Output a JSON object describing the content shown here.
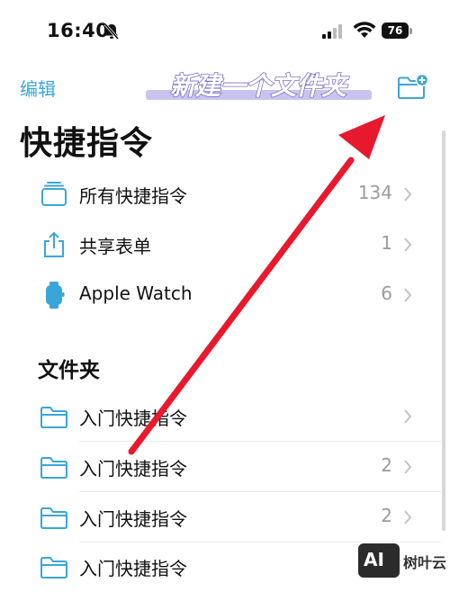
{
  "status_bar": {
    "time": "16:40",
    "battery": "76",
    "icons": [
      "bell-slash-icon",
      "cellular-signal-icon",
      "wifi-icon",
      "battery-icon"
    ]
  },
  "nav": {
    "edit_label": "编辑",
    "banner_text": "新建一个文件夹",
    "new_folder_icon": "folder-plus-icon"
  },
  "page_title": "快捷指令",
  "shortcut_groups": [
    {
      "label": "所有快捷指令",
      "count": "134",
      "icon": "stack-icon"
    },
    {
      "label": "共享表单",
      "count": "1",
      "icon": "share-icon"
    },
    {
      "label": "Apple Watch",
      "count": "6",
      "icon": "apple-watch-icon"
    }
  ],
  "folders_section": {
    "title": "文件夹",
    "items": [
      {
        "label": "入门快捷指令",
        "count": "",
        "icon": "folder-icon"
      },
      {
        "label": "入门快捷指令",
        "count": "2",
        "icon": "folder-icon"
      },
      {
        "label": "入门快捷指令",
        "count": "2",
        "icon": "folder-icon"
      },
      {
        "label": "入门快捷指令",
        "count": "",
        "icon": "folder-icon"
      }
    ]
  },
  "watermark": {
    "logo": "AI",
    "text": "树叶云"
  },
  "colors": {
    "accent": "#3aa6d8",
    "arrow": "#e8192c",
    "banner_text": "#ffffff",
    "banner_bg": "#c9c4ef"
  }
}
